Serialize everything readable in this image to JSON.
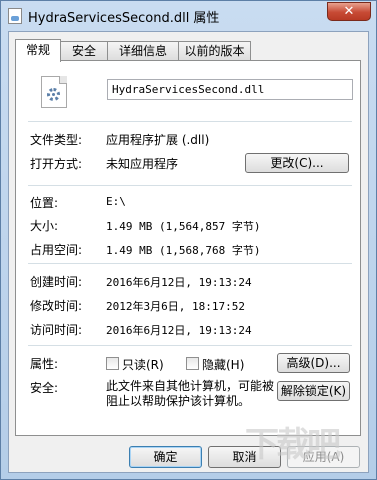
{
  "window": {
    "title": "HydraServicesSecond.dll 属性",
    "close_label": "✕"
  },
  "tabs": [
    "常规",
    "安全",
    "详细信息",
    "以前的版本"
  ],
  "general": {
    "file_name": "HydraServicesSecond.dll",
    "type_label": "文件类型:",
    "type_value": "应用程序扩展 (.dll)",
    "open_with_label": "打开方式:",
    "open_with_value": "未知应用程序",
    "change_button": "更改(C)...",
    "location_label": "位置:",
    "location_value": "E:\\",
    "size_label": "大小:",
    "size_value": "1.49 MB (1,564,857 字节)",
    "size_on_disk_label": "占用空间:",
    "size_on_disk_value": "1.49 MB (1,568,768 字节)",
    "created_label": "创建时间:",
    "created_value": "2016年6月12日, 19:13:24",
    "modified_label": "修改时间:",
    "modified_value": "2012年3月6日, 18:17:52",
    "accessed_label": "访问时间:",
    "accessed_value": "2016年6月12日, 19:13:24",
    "attributes_label": "属性:",
    "readonly_label": "只读(R)",
    "hidden_label": "隐藏(H)",
    "advanced_button": "高级(D)...",
    "security_label": "安全:",
    "security_text": "此文件来自其他计算机，可能被阻止以帮助保护该计算机。",
    "unblock_button": "解除锁定(K)"
  },
  "footer": {
    "ok": "确定",
    "cancel": "取消",
    "apply": "应用(A)"
  },
  "watermark": "下载吧",
  "icons": {
    "file": "dll-gear-file-icon",
    "close": "close-icon"
  }
}
